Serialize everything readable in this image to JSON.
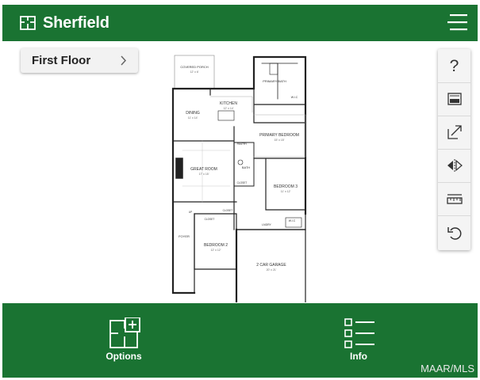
{
  "header": {
    "title": "Sherfield",
    "logo_icon": "floorplan-icon",
    "menu_icon": "hamburger-menu-icon"
  },
  "floor_selector": {
    "label": "First Floor",
    "icon": "chevron-right-icon"
  },
  "toolbar": {
    "items": [
      {
        "icon": "help-icon",
        "glyph": "?"
      },
      {
        "icon": "furniture-view-icon"
      },
      {
        "icon": "expand-icon"
      },
      {
        "icon": "mirror-flip-icon"
      },
      {
        "icon": "measure-ruler-icon"
      },
      {
        "icon": "undo-icon"
      }
    ]
  },
  "floor_plan": {
    "rooms": [
      {
        "name": "COVERED PORCH",
        "dims": "12' x 6'"
      },
      {
        "name": "PRIMARY BATH"
      },
      {
        "name": "W.I.C"
      },
      {
        "name": "KITCHEN",
        "dims": "12' x 14'"
      },
      {
        "name": "DINING",
        "dims": "11' x 14'"
      },
      {
        "name": "PRIMARY BEDROOM",
        "dims": "15' x 15'"
      },
      {
        "name": "PANTRY"
      },
      {
        "name": "GREAT ROOM",
        "dims": "17' x 15'"
      },
      {
        "name": "BATH"
      },
      {
        "name": "CLOSET"
      },
      {
        "name": "BEDROOM 3",
        "dims": "11' x 12'"
      },
      {
        "name": "UP"
      },
      {
        "name": "CLOSET"
      },
      {
        "name": "CLOSET"
      },
      {
        "name": "W.I.C"
      },
      {
        "name": "LNDRY"
      },
      {
        "name": "FOYER"
      },
      {
        "name": "BEDROOM 2",
        "dims": "12' x 12'"
      },
      {
        "name": "2 CAR GARAGE",
        "dims": "20' x 21'"
      }
    ]
  },
  "bottom_bar": {
    "options": {
      "label": "Options",
      "icon": "options-layout-icon"
    },
    "info": {
      "label": "Info",
      "icon": "list-info-icon"
    }
  },
  "watermark": "MAAR/MLS",
  "colors": {
    "brand_green": "#1a7332",
    "white": "#ffffff"
  }
}
